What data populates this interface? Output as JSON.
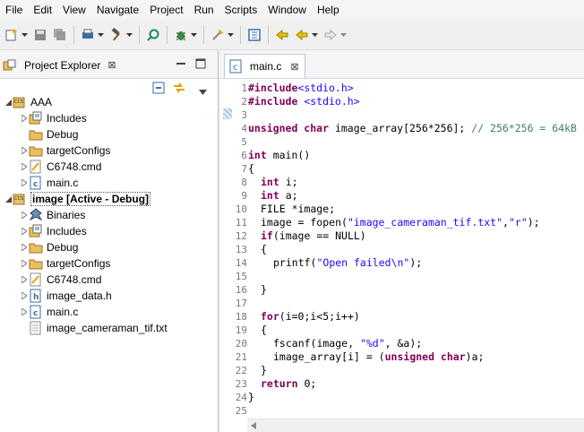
{
  "menu": [
    "File",
    "Edit",
    "View",
    "Navigate",
    "Project",
    "Run",
    "Scripts",
    "Window",
    "Help"
  ],
  "project_explorer": {
    "tab_label": "Project Explorer",
    "close": "⊠"
  },
  "tree": [
    {
      "label": "AAA",
      "level": 0,
      "expanded": true,
      "icon": "ccs-project"
    },
    {
      "label": "Includes",
      "level": 1,
      "expanded": false,
      "icon": "includes"
    },
    {
      "label": "Debug",
      "level": 1,
      "expanded": null,
      "icon": "folder"
    },
    {
      "label": "targetConfigs",
      "level": 1,
      "expanded": false,
      "icon": "folder"
    },
    {
      "label": "C6748.cmd",
      "level": 1,
      "expanded": false,
      "icon": "cmd-file"
    },
    {
      "label": "main.c",
      "level": 1,
      "expanded": false,
      "icon": "c-file"
    },
    {
      "label": "image  [Active - Debug]",
      "level": 0,
      "expanded": true,
      "icon": "ccs-project",
      "active": true
    },
    {
      "label": "Binaries",
      "level": 1,
      "expanded": false,
      "icon": "binaries"
    },
    {
      "label": "Includes",
      "level": 1,
      "expanded": false,
      "icon": "includes"
    },
    {
      "label": "Debug",
      "level": 1,
      "expanded": false,
      "icon": "folder"
    },
    {
      "label": "targetConfigs",
      "level": 1,
      "expanded": false,
      "icon": "folder"
    },
    {
      "label": "C6748.cmd",
      "level": 1,
      "expanded": false,
      "icon": "cmd-file"
    },
    {
      "label": "image_data.h",
      "level": 1,
      "expanded": false,
      "icon": "h-file"
    },
    {
      "label": "main.c",
      "level": 1,
      "expanded": false,
      "icon": "c-file"
    },
    {
      "label": "image_cameraman_tif.txt",
      "level": 1,
      "expanded": null,
      "icon": "txt-file"
    }
  ],
  "editor": {
    "tab_label": "main.c",
    "close": "⊠",
    "lines": [
      {
        "n": "1",
        "indent": 0,
        "tokens": [
          [
            "kw",
            "#include"
          ],
          [
            "st",
            "<stdio.h>"
          ]
        ]
      },
      {
        "n": "2",
        "indent": 0,
        "tokens": [
          [
            "kw",
            "#include"
          ],
          [
            "",
            ""
          ],
          [
            "st",
            " <stdio.h>"
          ]
        ]
      },
      {
        "n": "3",
        "indent": 0,
        "tokens": []
      },
      {
        "n": "4",
        "indent": 0,
        "tokens": [
          [
            "kw",
            "unsigned char"
          ],
          [
            "",
            " image_array[256*256]; "
          ],
          [
            "cm",
            "// 256*256 = 64kB"
          ]
        ]
      },
      {
        "n": "5",
        "indent": 0,
        "tokens": []
      },
      {
        "n": "6",
        "indent": 0,
        "tokens": [
          [
            "kw",
            "int"
          ],
          [
            "",
            " main()"
          ]
        ]
      },
      {
        "n": "7",
        "indent": 0,
        "tokens": [
          [
            "",
            "{"
          ]
        ]
      },
      {
        "n": "8",
        "indent": 1,
        "tokens": [
          [
            "kw",
            "int"
          ],
          [
            "",
            " i;"
          ]
        ]
      },
      {
        "n": "9",
        "indent": 1,
        "tokens": [
          [
            "kw",
            "int"
          ],
          [
            "",
            " a;"
          ]
        ]
      },
      {
        "n": "10",
        "indent": 1,
        "tokens": [
          [
            "",
            "FILE *image;"
          ]
        ]
      },
      {
        "n": "11",
        "indent": 1,
        "tokens": [
          [
            "",
            "image = fopen("
          ],
          [
            "st",
            "\"image_cameraman_tif.txt\""
          ],
          [
            "",
            ","
          ],
          [
            "st",
            "\"r\""
          ],
          [
            "",
            ");"
          ]
        ]
      },
      {
        "n": "12",
        "indent": 1,
        "tokens": [
          [
            "kw",
            "if"
          ],
          [
            "",
            "(image == NULL)"
          ]
        ]
      },
      {
        "n": "13",
        "indent": 1,
        "tokens": [
          [
            "",
            "{"
          ]
        ]
      },
      {
        "n": "14",
        "indent": 2,
        "tokens": [
          [
            "",
            "printf("
          ],
          [
            "st",
            "\"Open failed\\n\""
          ],
          [
            "",
            ");"
          ]
        ]
      },
      {
        "n": "15",
        "indent": 0,
        "tokens": []
      },
      {
        "n": "16",
        "indent": 1,
        "tokens": [
          [
            "",
            "}"
          ]
        ]
      },
      {
        "n": "17",
        "indent": 0,
        "tokens": []
      },
      {
        "n": "18",
        "indent": 1,
        "tokens": [
          [
            "kw",
            "for"
          ],
          [
            "",
            "(i=0;i<5;i++)"
          ]
        ]
      },
      {
        "n": "19",
        "indent": 1,
        "tokens": [
          [
            "",
            "{"
          ]
        ]
      },
      {
        "n": "20",
        "indent": 2,
        "tokens": [
          [
            "",
            "fscanf(image, "
          ],
          [
            "st",
            "\"%d\""
          ],
          [
            "",
            ", &a);"
          ]
        ]
      },
      {
        "n": "21",
        "indent": 2,
        "tokens": [
          [
            "",
            "image_array[i] = ("
          ],
          [
            "kw",
            "unsigned char"
          ],
          [
            "",
            ")a;"
          ]
        ]
      },
      {
        "n": "22",
        "indent": 1,
        "tokens": [
          [
            "",
            "}"
          ]
        ]
      },
      {
        "n": "23",
        "indent": 1,
        "tokens": [
          [
            "kw",
            "return"
          ],
          [
            "",
            " 0;"
          ]
        ]
      },
      {
        "n": "24",
        "indent": 0,
        "tokens": [
          [
            "",
            "}"
          ]
        ]
      },
      {
        "n": "25",
        "indent": 0,
        "tokens": []
      }
    ]
  },
  "colors": {
    "keyword": "#7f0055",
    "string": "#2a00ff",
    "comment": "#3f7f5f"
  }
}
